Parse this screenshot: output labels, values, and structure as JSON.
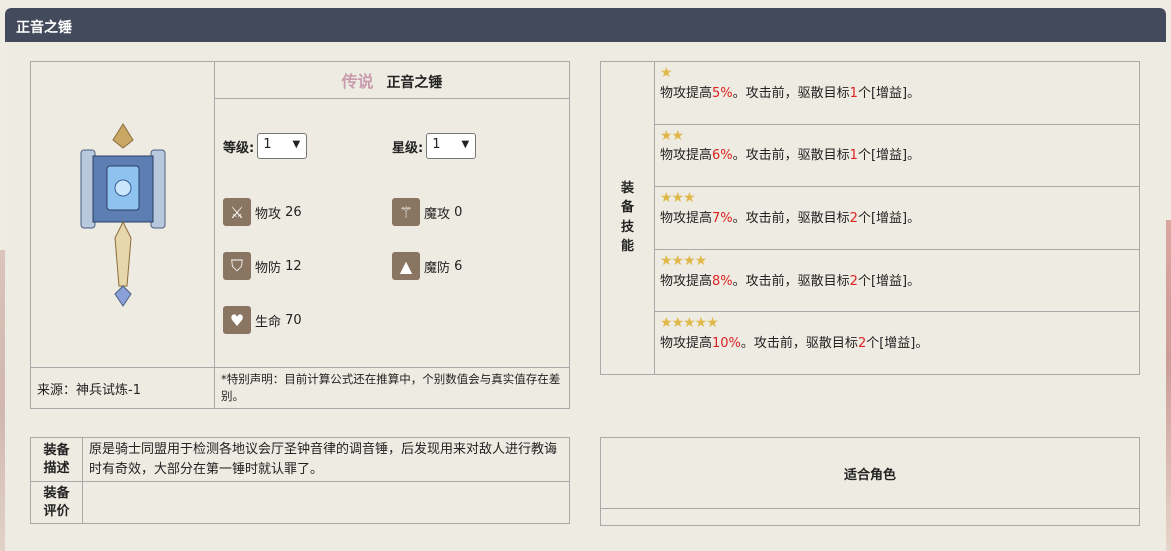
{
  "header": {
    "title": "正音之锤"
  },
  "equipment": {
    "rarity": "传说",
    "name": "正音之锤",
    "level_label": "等级:",
    "level_value": "1",
    "star_label": "星级:",
    "star_value": "1",
    "stats": [
      {
        "icon": "sword-icon",
        "label": "物攻",
        "value": "26"
      },
      {
        "icon": "wand-icon",
        "label": "魔攻",
        "value": "0"
      },
      {
        "icon": "shield-icon",
        "label": "物防",
        "value": "12"
      },
      {
        "icon": "wizard-hat-icon",
        "label": "魔防",
        "value": "6"
      },
      {
        "icon": "heart-icon",
        "label": "生命",
        "value": "70"
      }
    ],
    "source": "来源：神兵试炼-1",
    "note": "*特别声明：目前计算公式还在推算中，个别数值会与真实值存在差别。"
  },
  "skills": {
    "label": "装备技能",
    "items": [
      {
        "stars": 1,
        "pre": "物攻提高",
        "pct": "5%",
        "mid": "。攻击前，驱散目标",
        "num": "1",
        "post": "个[增益]。"
      },
      {
        "stars": 2,
        "pre": "物攻提高",
        "pct": "6%",
        "mid": "。攻击前，驱散目标",
        "num": "1",
        "post": "个[增益]。"
      },
      {
        "stars": 3,
        "pre": "物攻提高",
        "pct": "7%",
        "mid": "。攻击前，驱散目标",
        "num": "2",
        "post": "个[增益]。"
      },
      {
        "stars": 4,
        "pre": "物攻提高",
        "pct": "8%",
        "mid": "。攻击前，驱散目标",
        "num": "2",
        "post": "个[增益]。"
      },
      {
        "stars": 5,
        "pre": "物攻提高",
        "pct": "10%",
        "mid": "。攻击前，驱散目标",
        "num": "2",
        "post": "个[增益]。"
      }
    ]
  },
  "description": {
    "desc_label": "装备描述",
    "desc_text": "原是骑士同盟用于检测各地议会厅圣钟音律的调音锤，后发现用来对敌人进行教诲时有奇效，大部分在第一锤时就认罪了。",
    "eval_label": "装备评价",
    "eval_text": ""
  },
  "fit": {
    "title": "适合角色"
  },
  "colors": {
    "header_bg": "#424a5c",
    "highlight": "#dd2222",
    "star": "#e0b84a",
    "rarity": "#c89cae"
  }
}
